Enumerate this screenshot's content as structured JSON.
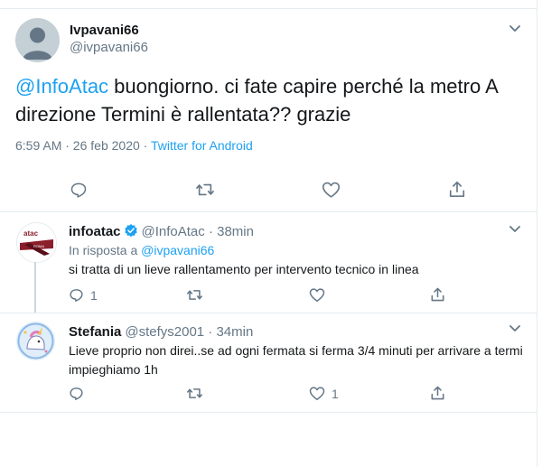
{
  "main_tweet": {
    "display_name": "Ivpavani66",
    "handle": "@ivpavani66",
    "mention": "@InfoAtac",
    "text_rest": " buongiorno.  ci fate capire perché la metro A direzione Termini è rallentata?? grazie",
    "timestamp": "6:59 AM · 26 feb 2020 · ",
    "source": "Twitter for Android"
  },
  "replies": [
    {
      "display_name": "infoatac",
      "handle": "@InfoAtac · 38min",
      "in_reply_prefix": "In risposta a ",
      "in_reply_handle": "@ivpavani66",
      "text": "si tratta di un lieve rallentamento per intervento tecnico in linea",
      "reply_count": "1",
      "like_count": "",
      "avatar_text": "atac",
      "avatar_subtext": "ROMA"
    },
    {
      "display_name": "Stefania",
      "handle": "@stefys2001 · 34min",
      "text": "Lieve proprio non direi..se ad ogni fermata si ferma 3/4 minuti per arrivare a termi impieghiamo 1h",
      "reply_count": "",
      "like_count": "1"
    }
  ],
  "icons": [
    "reply-icon",
    "retweet-icon",
    "like-icon",
    "share-icon",
    "chevron-down-icon",
    "verified-badge-icon"
  ],
  "colors": {
    "accent": "#1da1f2",
    "muted": "#657786",
    "text": "#14171a",
    "border": "#e6ecf0",
    "atac_red": "#8b1e2b"
  }
}
